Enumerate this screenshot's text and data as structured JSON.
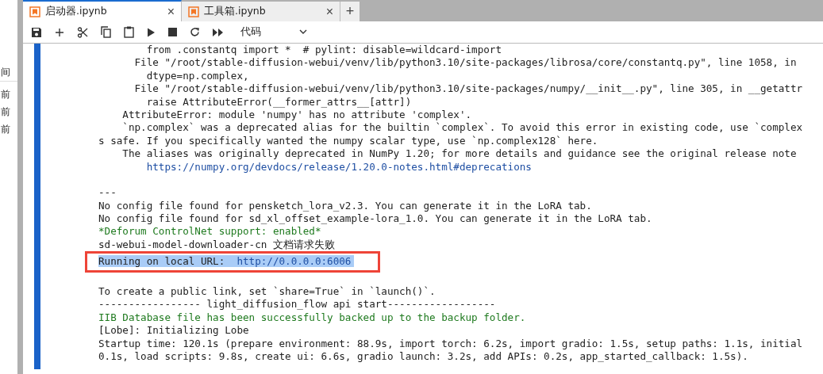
{
  "sidebar": {
    "header": "间",
    "items": [
      "前",
      "前",
      "前"
    ]
  },
  "tabs": [
    {
      "label": "启动器.ipynb",
      "selected": true,
      "close": "×"
    },
    {
      "label": "工具箱.ipynb",
      "selected": false,
      "close": "×"
    }
  ],
  "new_tab": "+",
  "toolbar": {
    "cell_type": "代码"
  },
  "output": {
    "lines": [
      {
        "kind": "text",
        "text": "        from .constantq import *  # pylint: disable=wildcard-import"
      },
      {
        "kind": "text",
        "text": "      File \"/root/stable-diffusion-webui/venv/lib/python3.10/site-packages/librosa/core/constantq.py\", line 1058, in"
      },
      {
        "kind": "text",
        "text": "        dtype=np.complex,"
      },
      {
        "kind": "text",
        "text": "      File \"/root/stable-diffusion-webui/venv/lib/python3.10/site-packages/numpy/__init__.py\", line 305, in __getattr"
      },
      {
        "kind": "text",
        "text": "        raise AttributeError(__former_attrs__[attr])"
      },
      {
        "kind": "text",
        "text": "    AttributeError: module 'numpy' has no attribute 'complex'."
      },
      {
        "kind": "text",
        "text": "    `np.complex` was a deprecated alias for the builtin `complex`. To avoid this error in existing code, use `complex"
      },
      {
        "kind": "text",
        "text": "s safe. If you specifically wanted the numpy scalar type, use `np.complex128` here."
      },
      {
        "kind": "text",
        "text": "    The aliases was originally deprecated in NumPy 1.20; for more details and guidance see the original release note"
      },
      {
        "kind": "link",
        "text": "        https://numpy.org/devdocs/release/1.20.0-notes.html#deprecations"
      },
      {
        "kind": "blank"
      },
      {
        "kind": "text",
        "text": "---"
      },
      {
        "kind": "text",
        "text": "No config file found for pensketch_lora_v2.3. You can generate it in the LoRA tab."
      },
      {
        "kind": "text",
        "text": "No config file found for sd_xl_offset_example-lora_1.0. You can generate it in the LoRA tab."
      },
      {
        "kind": "success",
        "text": "*Deforum ControlNet support: enabled*"
      },
      {
        "kind": "text",
        "text": "sd-webui-model-downloader-cn 文档请求失败"
      },
      {
        "kind": "highlighted",
        "text": "Running on local URL:  ",
        "url": "http://0.0.0.0:6006"
      },
      {
        "kind": "blank"
      },
      {
        "kind": "text",
        "text": "To create a public link, set `share=True` in `launch()`."
      },
      {
        "kind": "text",
        "text": "----------------- light_diffusion_flow api start------------------"
      },
      {
        "kind": "success",
        "text": "IIB Database file has been successfully backed up to the backup folder."
      },
      {
        "kind": "text",
        "text": "[Lobe]: Initializing Lobe"
      },
      {
        "kind": "text",
        "text": "Startup time: 120.1s (prepare environment: 88.9s, import torch: 6.2s, import gradio: 1.5s, setup paths: 1.1s, initial"
      },
      {
        "kind": "text",
        "text": "0.1s, load scripts: 9.8s, create ui: 6.6s, gradio launch: 3.2s, add APIs: 0.2s, app_started_callback: 1.5s)."
      }
    ]
  }
}
